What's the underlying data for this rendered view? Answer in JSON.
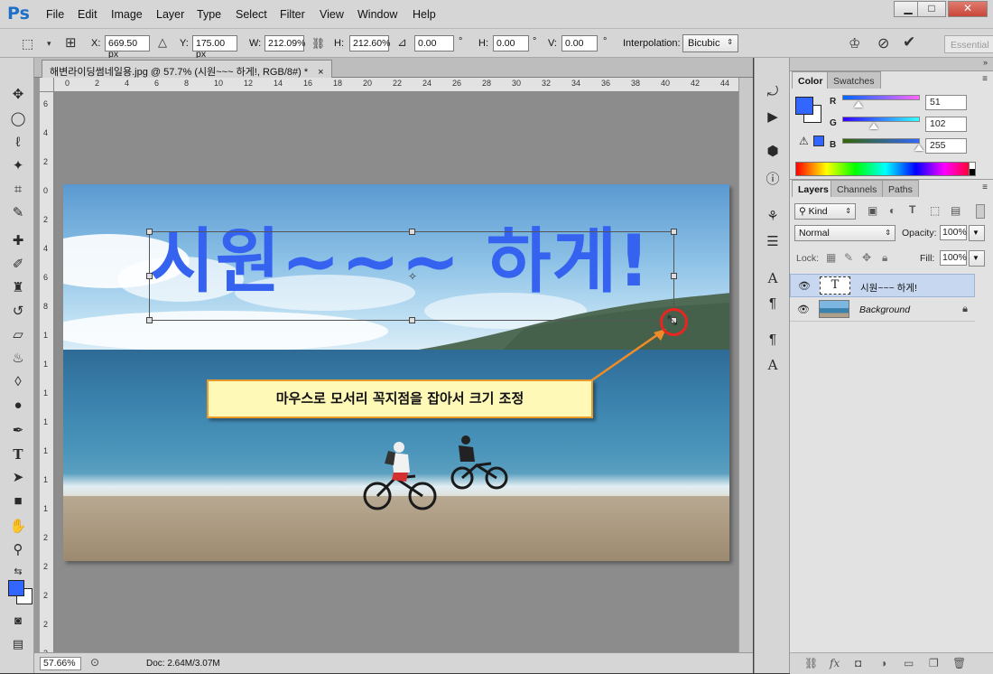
{
  "app": {
    "logo": "Ps"
  },
  "menu": [
    "File",
    "Edit",
    "Image",
    "Layer",
    "Type",
    "Select",
    "Filter",
    "View",
    "Window",
    "Help"
  ],
  "window_buttons": {
    "minimize": "▁",
    "maximize": "□",
    "close": "✕"
  },
  "options": {
    "x_label": "X:",
    "x_value": "669.50 px",
    "y_label": "Y:",
    "y_value": "175.00 px",
    "w_label": "W:",
    "w_value": "212.09%",
    "h_label": "H:",
    "h_value": "212.60%",
    "angle_value": "0.00",
    "angle_unit": "°",
    "hskew_label": "H:",
    "hskew_value": "0.00",
    "hskew_unit": "°",
    "vskew_label": "V:",
    "vskew_value": "0.00",
    "vskew_unit": "°",
    "interpolation_label": "Interpolation:",
    "interpolation_value": "Bicubic",
    "workspace": "Essential"
  },
  "document": {
    "tab_title": "해변라이딩썸네일용.jpg @ 57.7% (시원~~~ 하게!, RGB/8#) *",
    "tab_close": "×",
    "headline": "시원~~~ 하게!",
    "zoom": "57.66%",
    "doc_size": "Doc: 2.64M/3.07M"
  },
  "ruler": {
    "h_ticks": [
      "0",
      "2",
      "4",
      "6",
      "8",
      "10",
      "12",
      "14",
      "16",
      "18",
      "20",
      "22",
      "24",
      "26",
      "28",
      "30",
      "32",
      "34",
      "36",
      "38",
      "40",
      "42",
      "44"
    ],
    "v_ticks": [
      "6",
      "4",
      "2",
      "0",
      "2",
      "4",
      "6",
      "8",
      "1",
      "1",
      "1",
      "1",
      "1",
      "1",
      "1",
      "2",
      "2",
      "2",
      "2",
      "2"
    ]
  },
  "callout": {
    "text": "마우스로 모서리 꼭지점을 잡아서 크기 조정"
  },
  "color_panel": {
    "tabs": [
      "Color",
      "Swatches"
    ],
    "r_label": "R",
    "r_value": "51",
    "g_label": "G",
    "g_value": "102",
    "b_label": "B",
    "b_value": "255",
    "foreground": "#3366ff"
  },
  "layers_panel": {
    "tabs": [
      "Layers",
      "Channels",
      "Paths"
    ],
    "kind_label": "Kind",
    "blend_mode": "Normal",
    "opacity_label": "Opacity:",
    "opacity_value": "100%",
    "lock_label": "Lock:",
    "fill_label": "Fill:",
    "fill_value": "100%",
    "layers": [
      {
        "name": "시원~~~ 하게!",
        "type": "text",
        "selected": true,
        "thumb": "T"
      },
      {
        "name": "Background",
        "type": "image",
        "selected": false,
        "locked": true
      }
    ]
  },
  "colors": {
    "accent": "#3563f0",
    "callout_border": "#e89a2c",
    "highlight": "#e8261f"
  }
}
